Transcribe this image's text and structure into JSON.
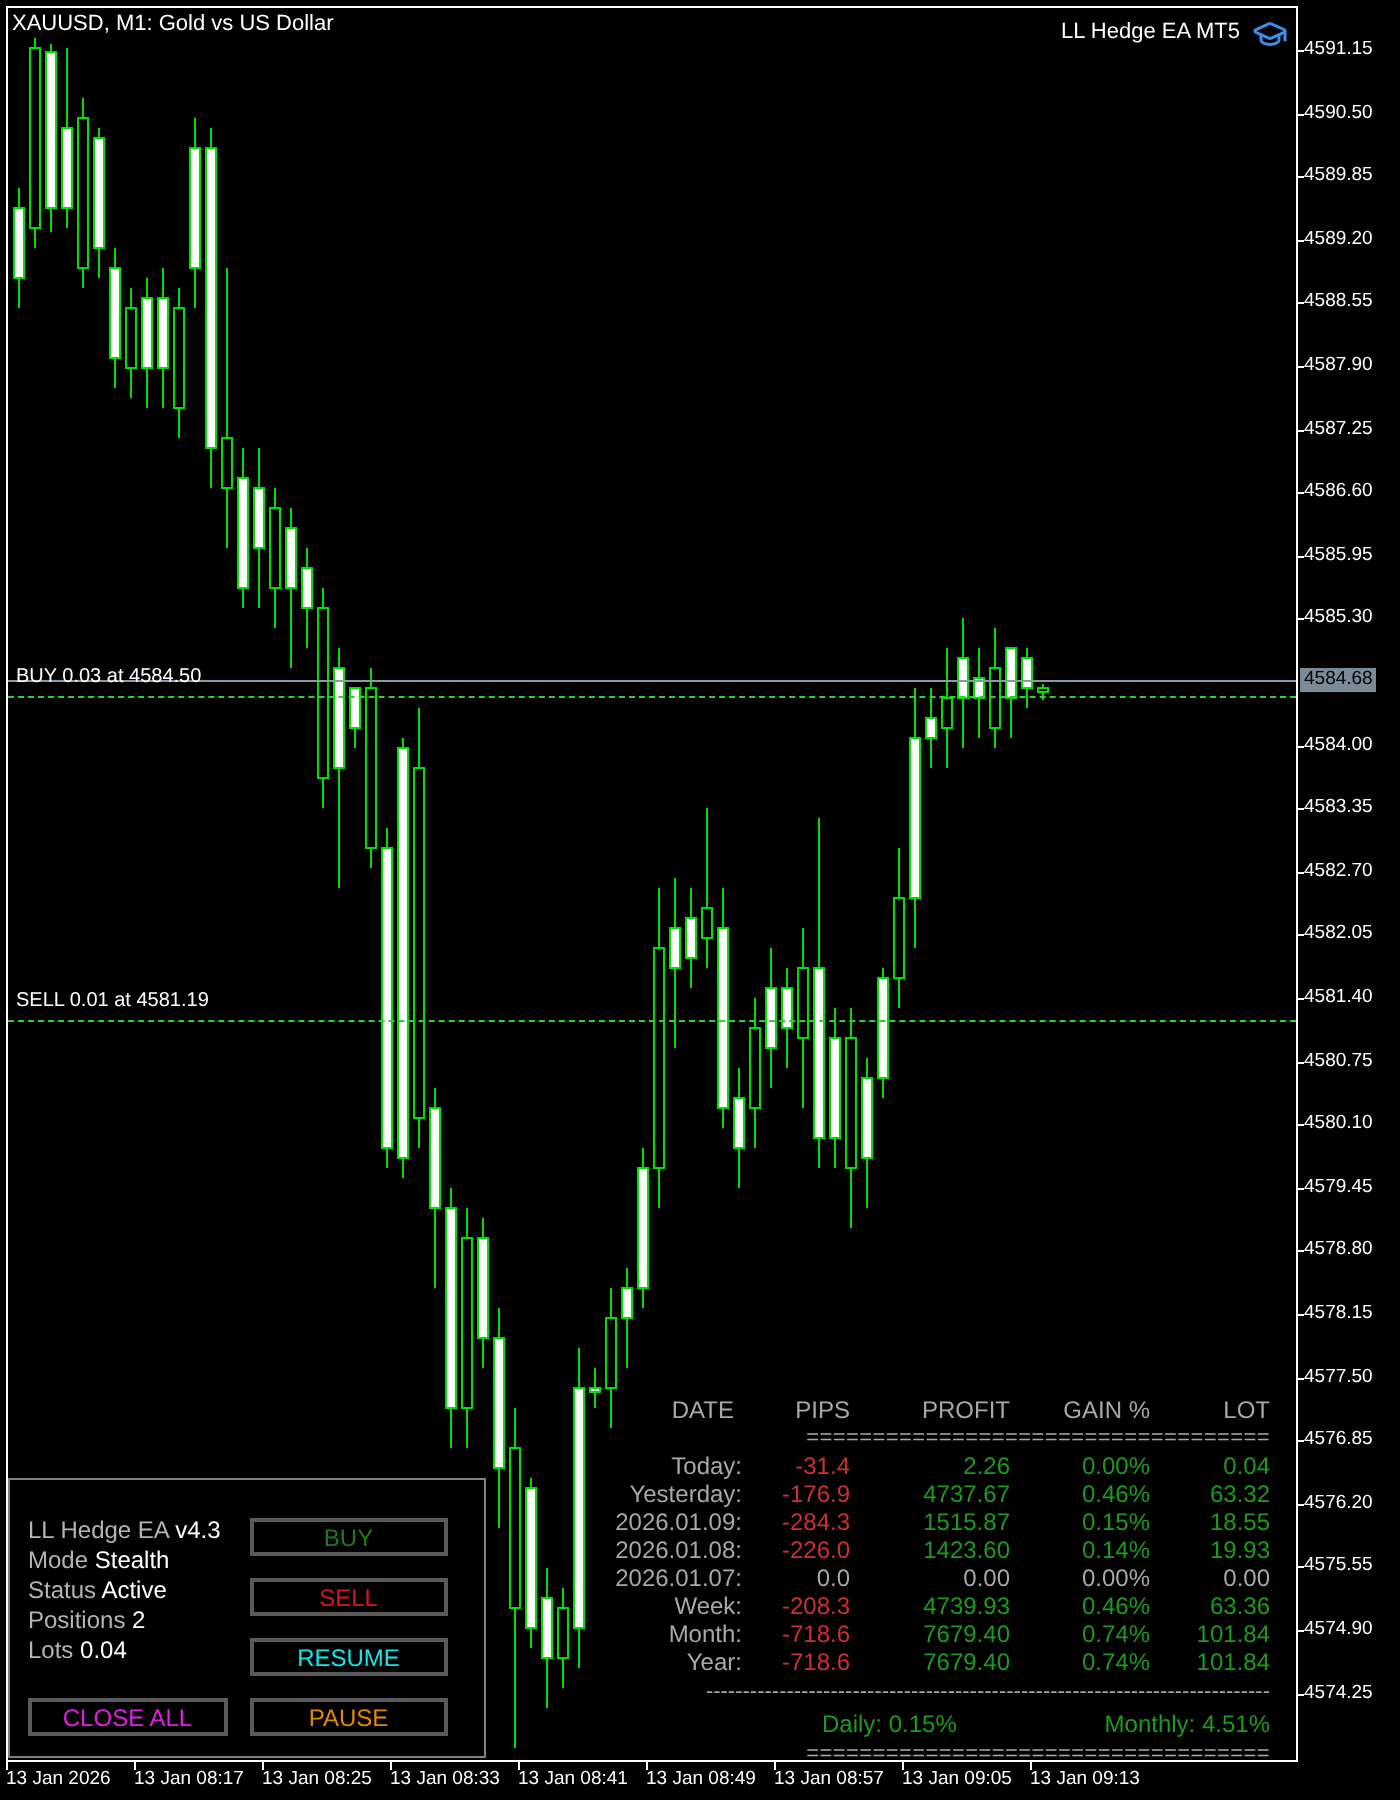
{
  "chart": {
    "title": "XAUUSD, M1:  Gold vs US Dollar",
    "brand": "LL Hedge EA MT5"
  },
  "price_axis": [
    {
      "label": "4591.15",
      "kind": "tick"
    },
    {
      "label": "4590.50",
      "kind": "tick"
    },
    {
      "label": "4589.85",
      "kind": "tick"
    },
    {
      "label": "4589.20",
      "kind": "tick"
    },
    {
      "label": "4588.55",
      "kind": "tick"
    },
    {
      "label": "4587.90",
      "kind": "tick"
    },
    {
      "label": "4587.25",
      "kind": "tick"
    },
    {
      "label": "4586.60",
      "kind": "tick"
    },
    {
      "label": "4585.95",
      "kind": "tick"
    },
    {
      "label": "4585.30",
      "kind": "tick"
    },
    {
      "label": "4584.68",
      "kind": "current"
    },
    {
      "label": "4584.00",
      "kind": "tick"
    },
    {
      "label": "4583.35",
      "kind": "tick"
    },
    {
      "label": "4582.70",
      "kind": "tick"
    },
    {
      "label": "4582.05",
      "kind": "tick"
    },
    {
      "label": "4581.40",
      "kind": "tick"
    },
    {
      "label": "4580.75",
      "kind": "tick"
    },
    {
      "label": "4580.10",
      "kind": "tick"
    },
    {
      "label": "4579.45",
      "kind": "tick"
    },
    {
      "label": "4578.80",
      "kind": "tick"
    },
    {
      "label": "4578.15",
      "kind": "tick"
    },
    {
      "label": "4577.50",
      "kind": "tick"
    },
    {
      "label": "4576.85",
      "kind": "tick"
    },
    {
      "label": "4576.20",
      "kind": "tick"
    },
    {
      "label": "4575.55",
      "kind": "tick"
    },
    {
      "label": "4574.90",
      "kind": "tick"
    },
    {
      "label": "4574.25",
      "kind": "tick"
    }
  ],
  "time_axis": [
    "13 Jan 2026",
    "13 Jan 08:17",
    "13 Jan 08:25",
    "13 Jan 08:33",
    "13 Jan 08:41",
    "13 Jan 08:49",
    "13 Jan 08:57",
    "13 Jan 09:05",
    "13 Jan 09:13"
  ],
  "orders": [
    {
      "label": "BUY 0.03 at 4584.50",
      "kind": "buy"
    },
    {
      "label": "SELL 0.01 at 4581.19",
      "kind": "sell"
    }
  ],
  "panel": {
    "lines": [
      {
        "label": "LL Hedge EA",
        "value": "v4.3"
      },
      {
        "label": "Mode",
        "value": "Stealth"
      },
      {
        "label": "Status",
        "value": "Active"
      },
      {
        "label": "Positions",
        "value": "2"
      },
      {
        "label": "Lots",
        "value": "0.04"
      }
    ],
    "buttons": [
      {
        "label": "BUY",
        "color": "#1e7a1e"
      },
      {
        "label": "SELL",
        "color": "#d81818"
      },
      {
        "label": "RESUME",
        "color": "#10e8e8"
      },
      {
        "label": "CLOSE ALL",
        "color": "#e020e0"
      },
      {
        "label": "PAUSE",
        "color": "#e08a00"
      }
    ]
  },
  "stats": {
    "columns": [
      "DATE",
      "PIPS",
      "PROFIT",
      "GAIN %",
      "LOT"
    ],
    "rule": "===================================",
    "rows": [
      {
        "cells": [
          "Today:",
          "-31.4",
          "2.26",
          "0.00%",
          "0.04"
        ],
        "flat": false
      },
      {
        "cells": [
          "Yesterday:",
          "-176.9",
          "4737.67",
          "0.46%",
          "63.32"
        ],
        "flat": false
      },
      {
        "cells": [
          "2026.01.09:",
          "-284.3",
          "1515.87",
          "0.15%",
          "18.55"
        ],
        "flat": false
      },
      {
        "cells": [
          "2026.01.08:",
          "-226.0",
          "1423.60",
          "0.14%",
          "19.93"
        ],
        "flat": false
      },
      {
        "cells": [
          "2026.01.07:",
          "0.0",
          "0.00",
          "0.00%",
          "0.00"
        ],
        "flat": true
      },
      {
        "cells": [
          "Week:",
          "-208.3",
          "4739.93",
          "0.46%",
          "63.36"
        ],
        "flat": false
      },
      {
        "cells": [
          "Month:",
          "-718.6",
          "7679.40",
          "0.74%",
          "101.84"
        ],
        "flat": false
      },
      {
        "cells": [
          "Year:",
          "-718.6",
          "7679.40",
          "0.74%",
          "101.84"
        ],
        "flat": false
      }
    ],
    "dash_rule": "-----------------------------------------------------------------------------",
    "daily": "Daily: 0.15%",
    "monthly": "Monthly: 4.51%",
    "end_rule": "==================================="
  }
}
